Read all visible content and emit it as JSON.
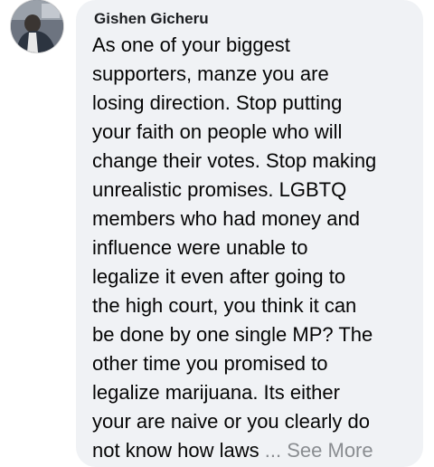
{
  "comment": {
    "author": "Gishen Gicheru",
    "lines": [
      "As one of your biggest",
      "supporters, manze you are",
      "losing direction. Stop putting",
      "your faith on people who will",
      "change their votes. Stop making",
      "unrealistic promises. LGBTQ",
      "members who had money and",
      "influence were unable to",
      "legalize it even after going to",
      "the high court, you think  it can",
      "be done by one single MP? The",
      "other time you promised to",
      "legalize marijuana. Its either",
      "your are naive or you clearly do",
      "not know how laws"
    ],
    "see_more": "... See More"
  },
  "colors": {
    "bubble_background": "#f0f2f5",
    "author_text": "#1c1e21",
    "body_text": "#050505",
    "see_more_text": "#8a8d91"
  }
}
